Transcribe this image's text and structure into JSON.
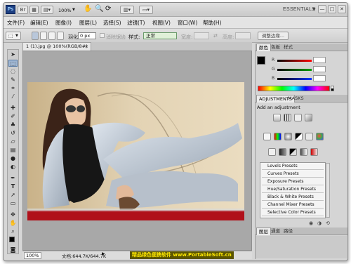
{
  "app": {
    "logo": "Ps",
    "zoom": "100%",
    "workspace": "ESSENTIALS"
  },
  "appbar_icons": [
    "br-icon",
    "mini-bridge-icon",
    "view-extras-icon",
    "zoom-select-icon",
    "hand-icon",
    "zoom-icon",
    "rotate-view-icon",
    "arrange-icon",
    "screen-mode-icon"
  ],
  "window_controls": [
    "—",
    "□",
    "✕"
  ],
  "menu": [
    "文件(F)",
    "编辑(E)",
    "图像(I)",
    "图层(L)",
    "选择(S)",
    "滤镜(T)",
    "视图(V)",
    "窗口(W)",
    "帮助(H)"
  ],
  "options": {
    "feather_label": "羽化:",
    "feather_value": "0 px",
    "antialias_label": "消除锯齿",
    "style_label": "样式:",
    "style_value": "正常",
    "width_label": "宽度:",
    "height_label": "高度:",
    "refine_edge": "调整边缘..."
  },
  "document": {
    "tab": "1 (1).jpg @ 100%(RGB/8#)",
    "tab_close": "×",
    "zoom_status": "100%",
    "doc_info": "文档:644.7K/644.7K",
    "watermark": "精品绿色便携软件 www.PortableSoft.cn"
  },
  "color_panel": {
    "tabs": [
      "颜色",
      "色板",
      "样式"
    ],
    "sliders": [
      {
        "letter": "R",
        "value": "",
        "color": "#ff0000"
      },
      {
        "letter": "G",
        "value": "",
        "color": "#00a000"
      },
      {
        "letter": "B",
        "value": "",
        "color": "#0033ff"
      }
    ]
  },
  "adjustments_panel": {
    "tabs": [
      "ADJUSTMENTS",
      "MASKS"
    ],
    "title": "Add an adjustment",
    "presets": [
      "Levels Presets",
      "Curves Presets",
      "Exposure Presets",
      "Hue/Saturation Presets",
      "Black & White Presets",
      "Channel Mixer Presets",
      "Selective Color Presets"
    ]
  },
  "layers_panel": {
    "tabs": [
      "图层",
      "通道",
      "路径"
    ]
  },
  "colors": {
    "accent": "#1d3f82",
    "selection": "#9fb6d2",
    "watermark_bg": "#5a5400",
    "watermark_fg": "#ffe800",
    "canvas_red": "#b0101a"
  }
}
